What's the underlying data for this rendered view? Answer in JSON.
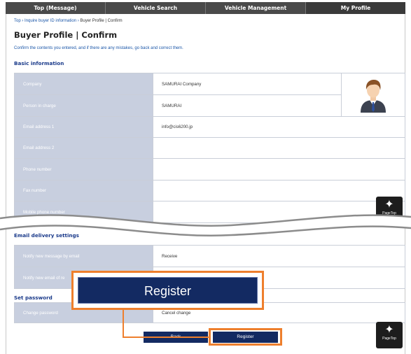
{
  "nav": {
    "items": [
      {
        "label": "Top (Message)"
      },
      {
        "label": "Vehicle Search"
      },
      {
        "label": "Vehicle Management"
      },
      {
        "label": "My Profile"
      }
    ]
  },
  "breadcrumb": {
    "top": "Top",
    "sep": "›",
    "inquire": "Inquire buyer ID information",
    "current": "Buyer Profile | Confirm"
  },
  "page": {
    "title": "Buyer Profile | Confirm",
    "intro": "Confirm the contents you entered, and if there are any mistakes, go back and correct them."
  },
  "basic": {
    "heading": "Basic information",
    "rows": [
      {
        "label": "Company",
        "value": "SAMURAI Company"
      },
      {
        "label": "Person in charge",
        "value": "SAMURAI"
      },
      {
        "label": "Email address 1",
        "value": "info@cis6200.jp"
      },
      {
        "label": "Email address 2",
        "value": ""
      },
      {
        "label": "Phone number",
        "value": ""
      },
      {
        "label": "Fax number",
        "value": ""
      },
      {
        "label": "Mobile phone number",
        "value": ""
      }
    ]
  },
  "email": {
    "heading": "Email delivery settings",
    "rows": [
      {
        "label": "Notify new message by email",
        "value": "Receive"
      },
      {
        "label": "Notify new email of re",
        "value": ""
      }
    ]
  },
  "password": {
    "heading": "Set password",
    "rows": [
      {
        "label": "Change password",
        "value": "Cancel change"
      }
    ]
  },
  "buttons": {
    "back": "Back",
    "register": "Register",
    "register_zoom": "Register"
  },
  "pagetop": {
    "label": "PageTop"
  },
  "colors": {
    "accent": "#ee7f2d",
    "button": "#132a62",
    "label_bg": "#c8cfdf",
    "nav_bg": "#4a4a4a",
    "heading": "#1a3a8a"
  }
}
